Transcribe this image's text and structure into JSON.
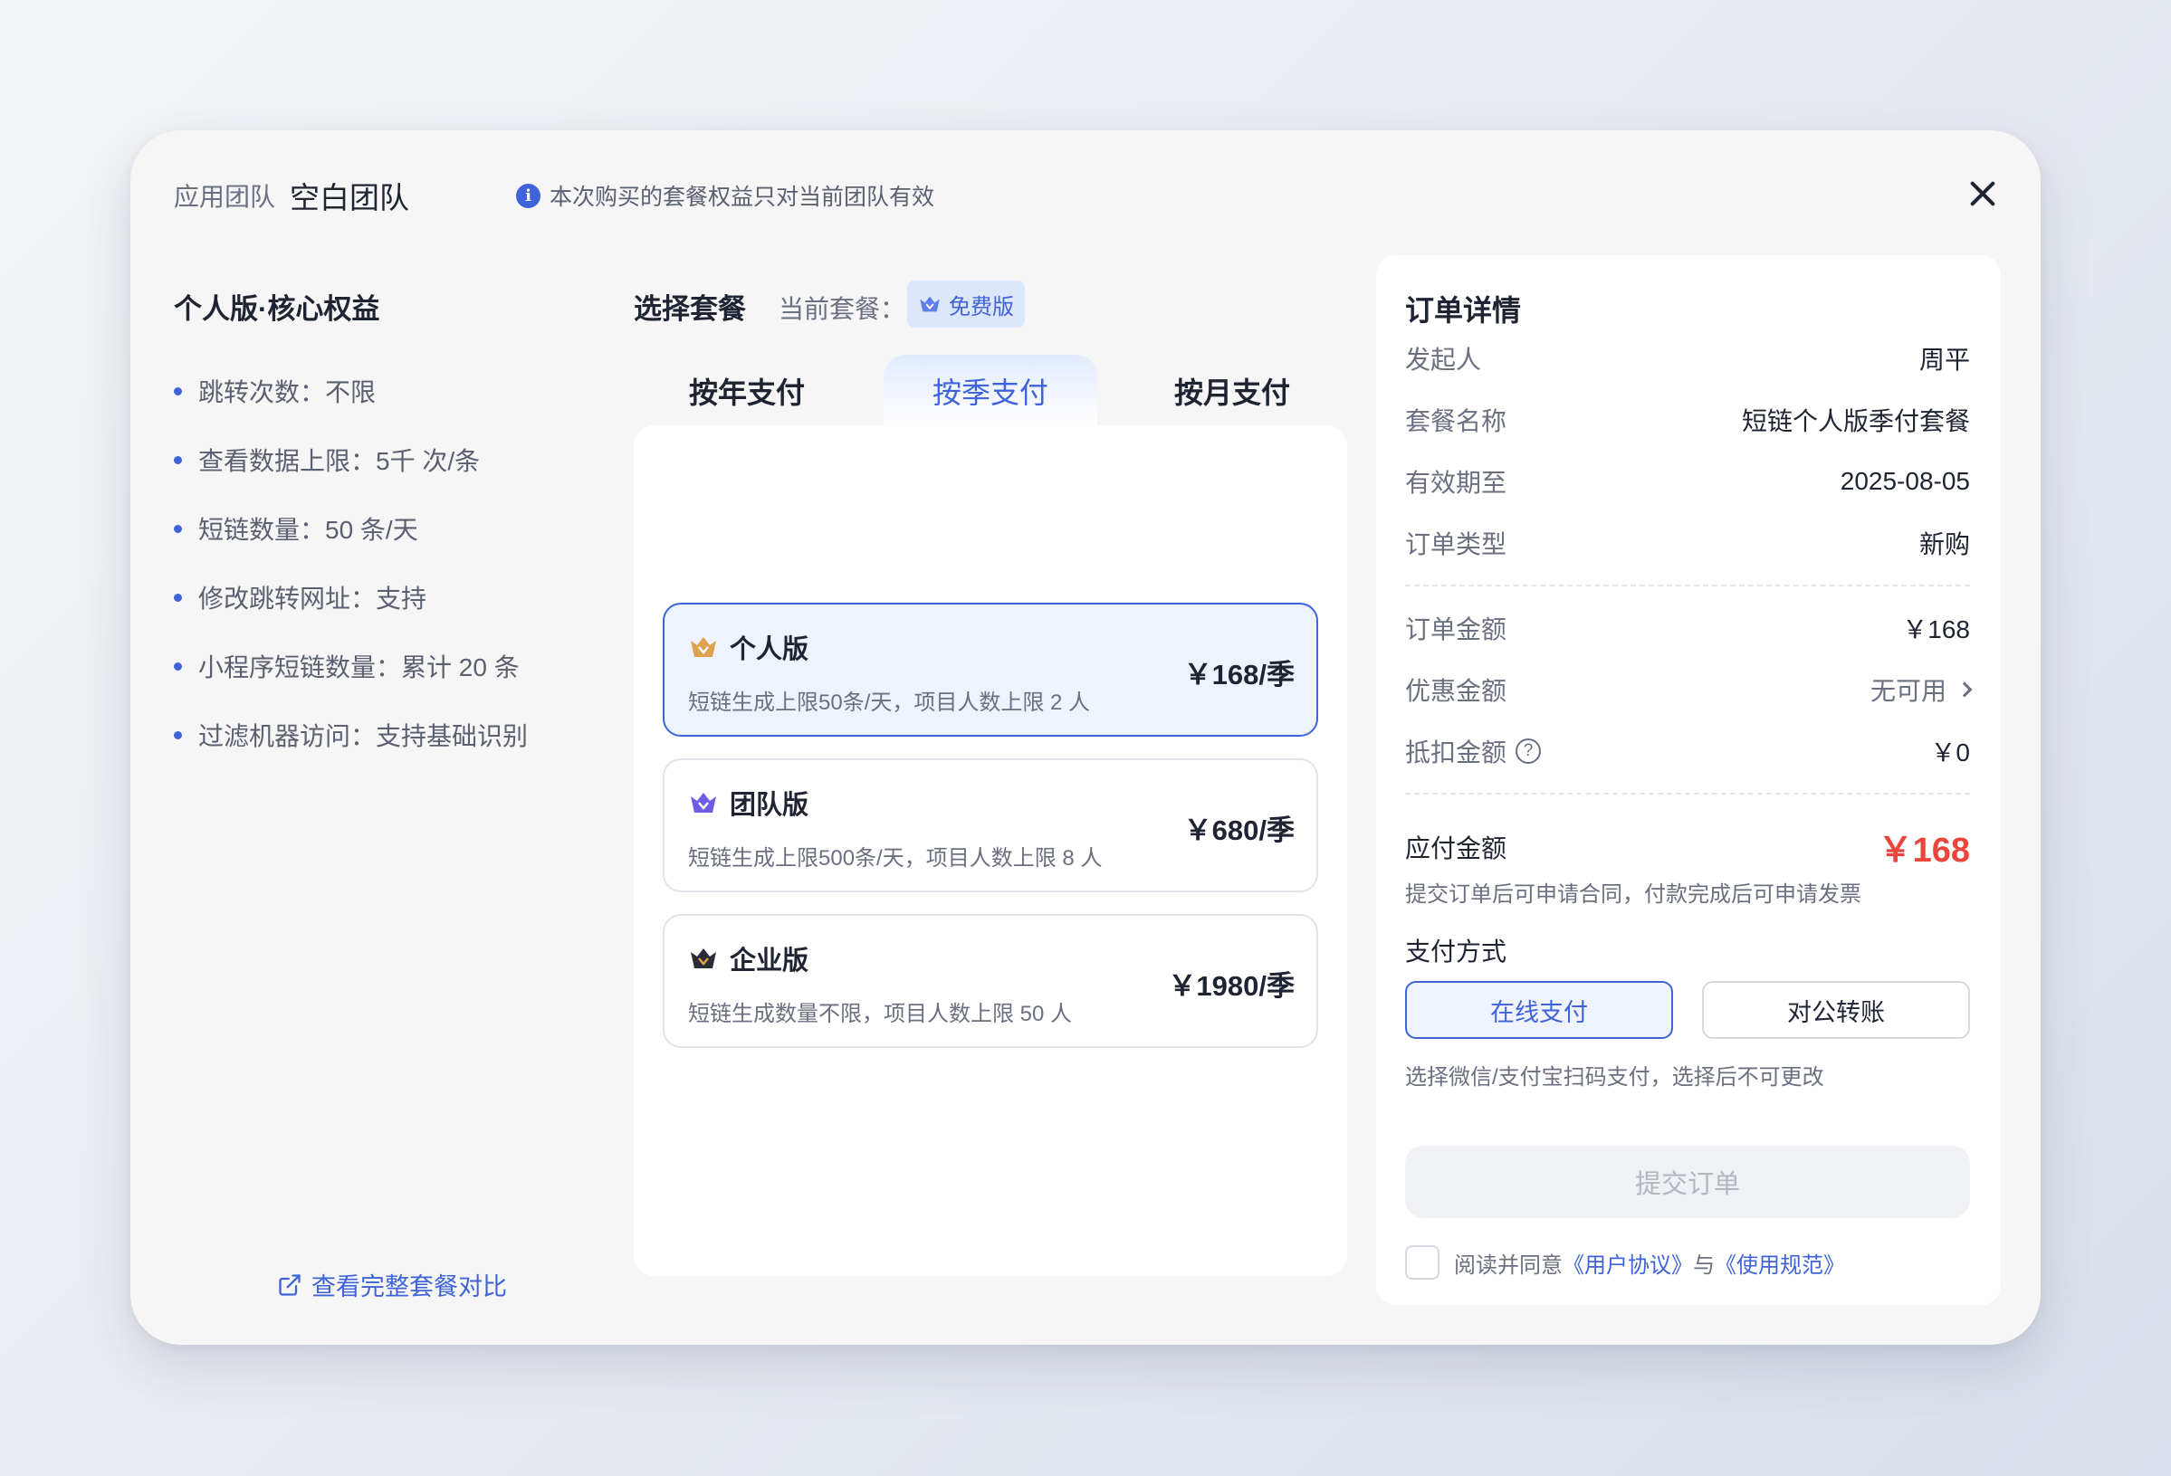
{
  "header": {
    "team_label": "应用团队",
    "team_name": "空白团队",
    "notice": "本次购买的套餐权益只对当前团队有效"
  },
  "benefits": {
    "title": "个人版·核心权益",
    "items": [
      "跳转次数：不限",
      "查看数据上限：5千 次/条",
      "短链数量：50 条/天",
      "修改跳转网址：支持",
      "小程序短链数量：累计 20 条",
      "过滤机器访问：支持基础识别"
    ],
    "compare_link": "查看完整套餐对比"
  },
  "plans": {
    "title": "选择套餐",
    "current_label": "当前套餐：",
    "current_plan": "免费版",
    "tabs": [
      "按年支付",
      "按季支付",
      "按月支付"
    ],
    "selected_tab": "按季支付",
    "cards": [
      {
        "name": "个人版",
        "desc": "短链生成上限50条/天，项目人数上限 2 人",
        "price": "￥168/季",
        "crown_color": "#e0a14f",
        "selected": true
      },
      {
        "name": "团队版",
        "desc": "短链生成上限500条/天，项目人数上限 8 人",
        "price": "￥680/季",
        "crown_color": "#6f5ce6",
        "selected": false
      },
      {
        "name": "企业版",
        "desc": "短链生成数量不限，项目人数上限 50 人",
        "price": "￥1980/季",
        "crown_color": "#2a2d38",
        "selected": false
      }
    ]
  },
  "order": {
    "title": "订单详情",
    "rows": [
      {
        "label": "发起人",
        "value": "周平"
      },
      {
        "label": "套餐名称",
        "value": "短链个人版季付套餐"
      },
      {
        "label": "有效期至",
        "value": "2025-08-05"
      },
      {
        "label": "订单类型",
        "value": "新购"
      }
    ],
    "amount_label": "订单金额",
    "amount_value": "￥168",
    "discount_label": "优惠金额",
    "discount_value": "无可用",
    "deduct_label": "抵扣金额",
    "deduct_value": "￥0",
    "pay_label": "应付金额",
    "pay_value": "￥168",
    "pay_note": "提交订单后可申请合同，付款完成后可申请发票",
    "method_label": "支付方式",
    "method_online": "在线支付",
    "method_transfer": "对公转账",
    "method_note": "选择微信/支付宝扫码支付，选择后不可更改",
    "submit": "提交订单",
    "agree_prefix": "阅读并同意",
    "agree_link1": "《用户协议》",
    "agree_mid": "与",
    "agree_link2": "《使用规范》"
  },
  "colors": {
    "accent": "#3f63d8",
    "price_red": "#e9453a"
  }
}
